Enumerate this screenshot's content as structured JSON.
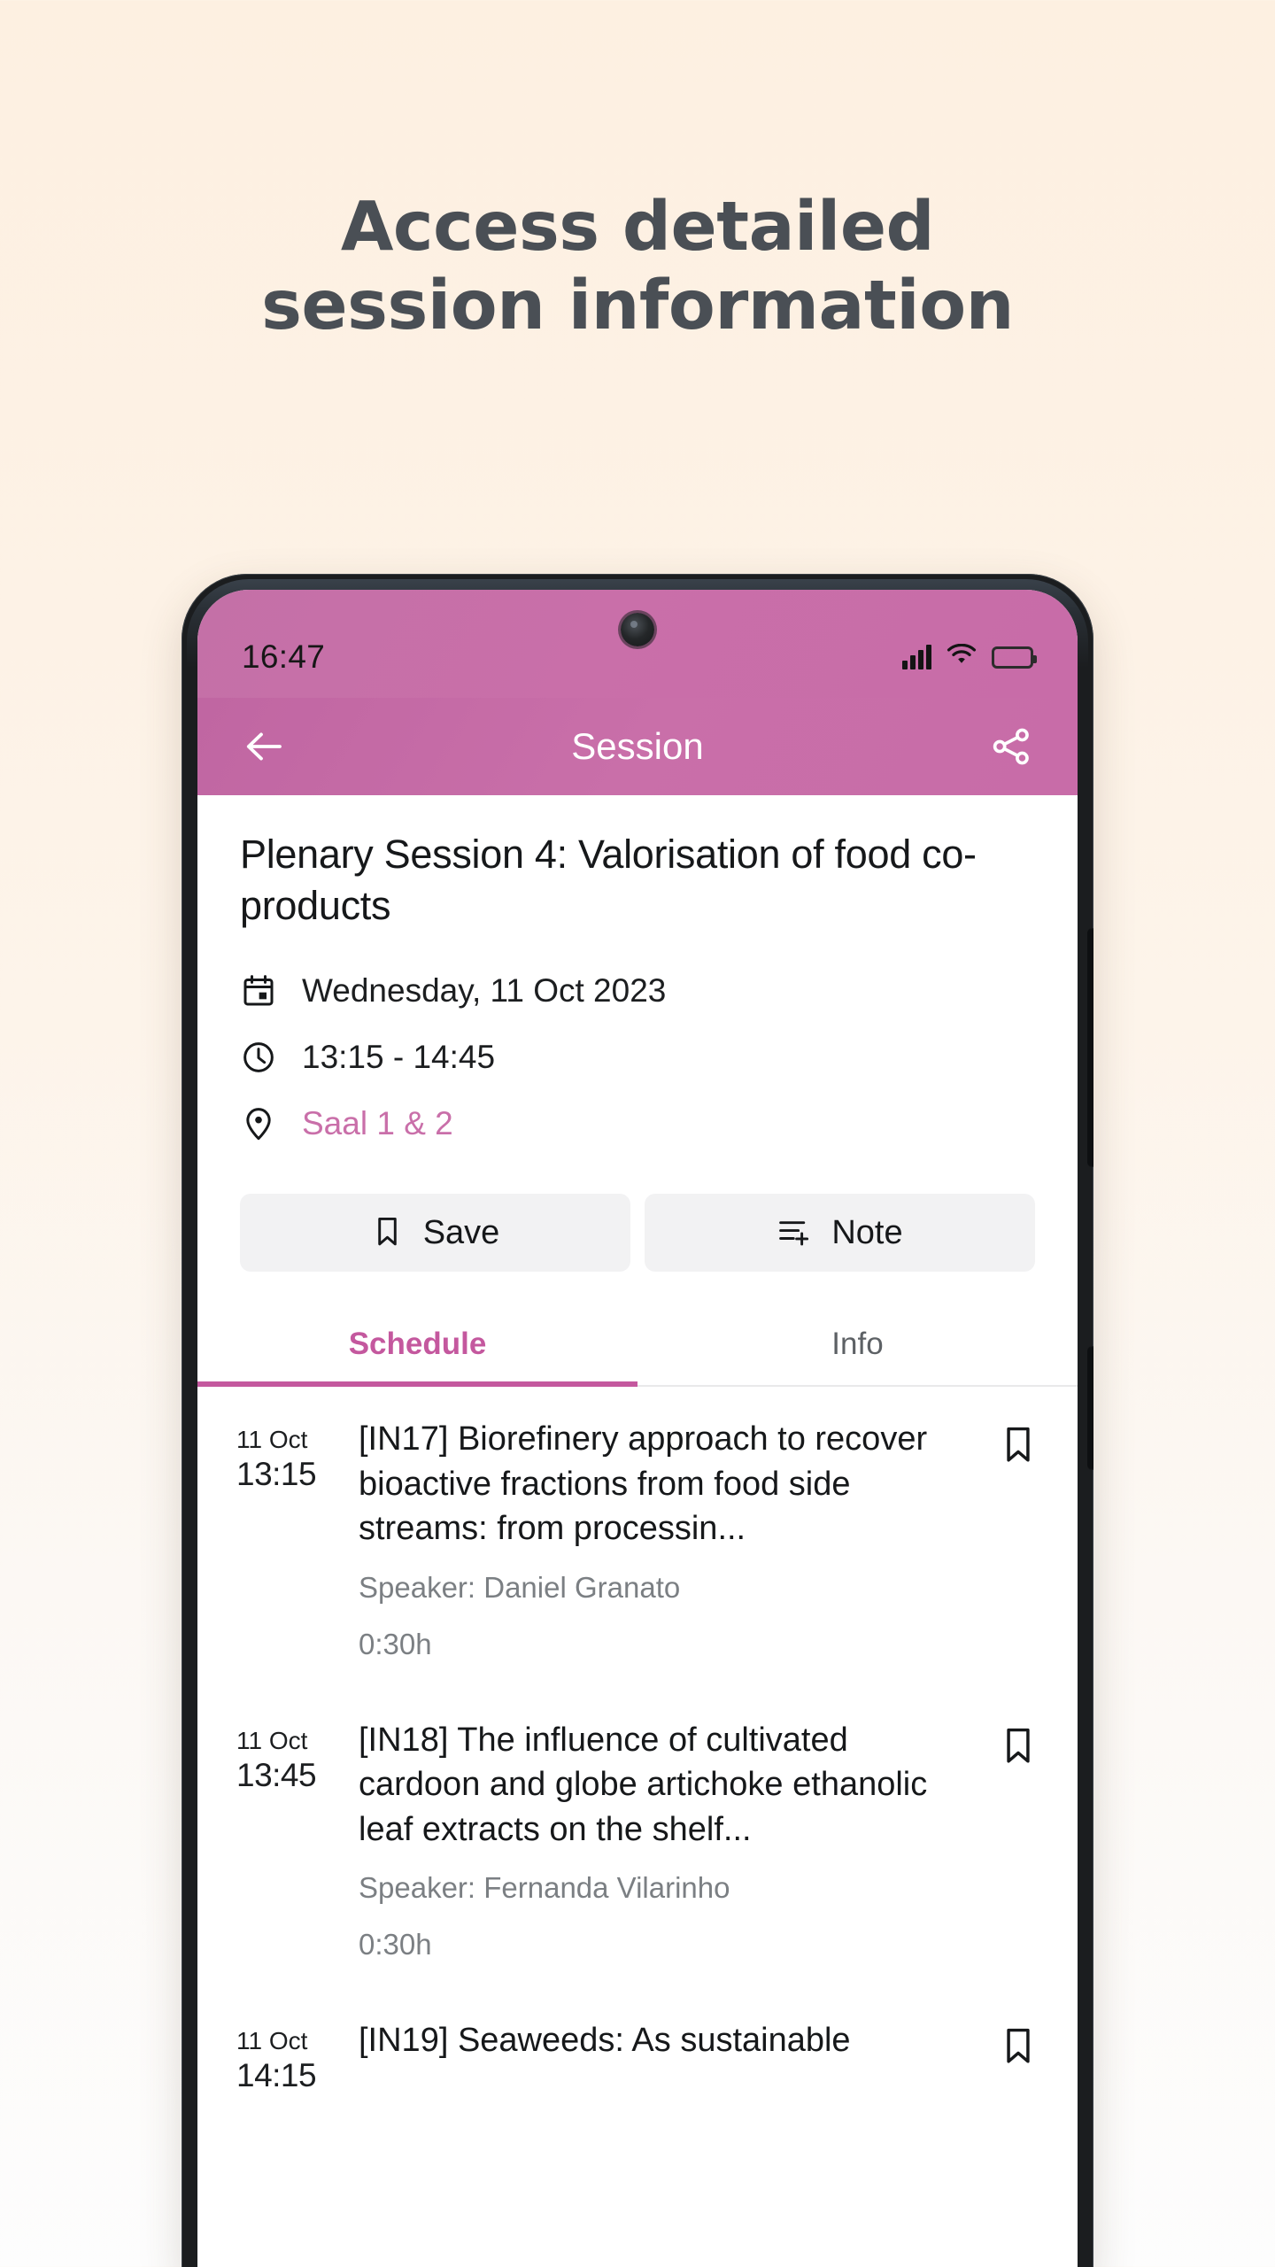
{
  "promo": {
    "heading_line1": "Access detailed",
    "heading_line2": "session information"
  },
  "colors": {
    "accent_pink": "#c96fa9",
    "tab_active": "#c4589e",
    "background_top": "#fdf0e1",
    "background_bottom": "#fdfdfd",
    "heading_text": "#4a4f55",
    "battery_fill": "#ffd21e"
  },
  "status_bar": {
    "time": "16:47",
    "signal_icon": "signal-bars-icon",
    "wifi_icon": "wifi-icon",
    "battery_icon": "battery-icon"
  },
  "app_bar": {
    "back_icon": "back-arrow-icon",
    "title": "Session",
    "share_icon": "share-icon"
  },
  "session": {
    "title": "Plenary Session 4: Valorisation of food co-products",
    "meta": [
      {
        "icon": "calendar-icon",
        "text": "Wednesday, 11 Oct 2023",
        "is_link": false
      },
      {
        "icon": "clock-icon",
        "text": "13:15 - 14:45",
        "is_link": false
      },
      {
        "icon": "location-pin-icon",
        "text": "Saal 1 & 2",
        "is_link": true
      }
    ]
  },
  "actions": {
    "save_label": "Save",
    "save_icon": "bookmark-icon",
    "note_label": "Note",
    "note_icon": "note-add-icon"
  },
  "tabs": {
    "items": [
      {
        "label": "Schedule",
        "active": true
      },
      {
        "label": "Info",
        "active": false
      }
    ]
  },
  "schedule": {
    "items": [
      {
        "date": "11 Oct",
        "time": "13:15",
        "title": "[IN17] Biorefinery approach to recover bioactive fractions from food side streams: from processin...",
        "speaker": "Speaker: Daniel Granato",
        "duration": "0:30h",
        "bookmark_icon": "bookmark-outline-icon"
      },
      {
        "date": "11 Oct",
        "time": "13:45",
        "title": "[IN18] The influence of cultivated cardoon and globe artichoke ethanolic leaf extracts on the shelf...",
        "speaker": "Speaker: Fernanda Vilarinho",
        "duration": "0:30h",
        "bookmark_icon": "bookmark-outline-icon"
      },
      {
        "date": "11 Oct",
        "time": "14:15",
        "title": "[IN19] Seaweeds: As sustainable",
        "speaker": "",
        "duration": "",
        "bookmark_icon": "bookmark-outline-icon"
      }
    ]
  }
}
